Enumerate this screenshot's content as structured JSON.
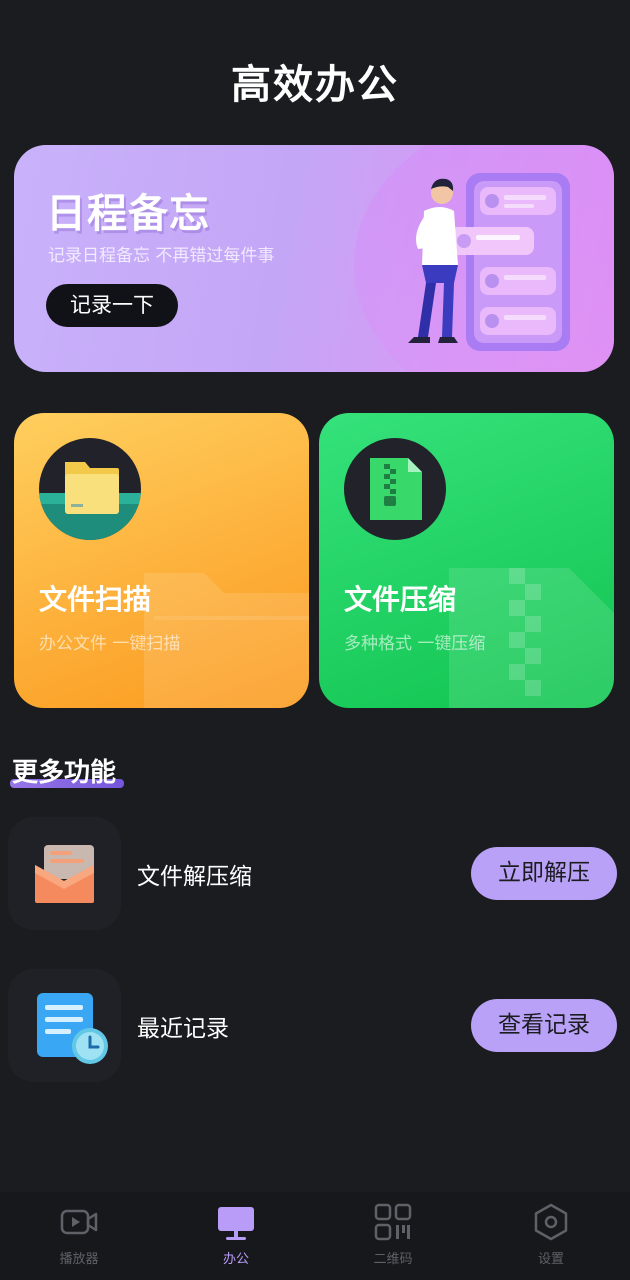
{
  "header": {
    "title": "高效办公"
  },
  "banner": {
    "title": "日程备忘",
    "subtitle": "记录日程备忘  不再错过每件事",
    "button_label": "记录一下"
  },
  "cards": [
    {
      "title": "文件扫描",
      "subtitle": "办公文件  一键扫描",
      "icon": "folder-icon",
      "color": "#fdb33e"
    },
    {
      "title": "文件压缩",
      "subtitle": "多种格式  一键压缩",
      "icon": "zip-file-icon",
      "color": "#22d163"
    }
  ],
  "more": {
    "title": "更多功能",
    "items": [
      {
        "label": "文件解压缩",
        "button_label": "立即解压",
        "icon": "open-envelope-icon"
      },
      {
        "label": "最近记录",
        "button_label": "查看记录",
        "icon": "document-clock-icon"
      }
    ]
  },
  "bottom_nav": {
    "items": [
      {
        "label": "播放器",
        "icon": "video-player-icon",
        "active": false
      },
      {
        "label": "办公",
        "icon": "monitor-icon",
        "active": true
      },
      {
        "label": "二维码",
        "icon": "qr-code-icon",
        "active": false
      },
      {
        "label": "设置",
        "icon": "hexagon-settings-icon",
        "active": false
      }
    ]
  },
  "colors": {
    "background": "#1b1c20",
    "accent": "#b8a1f6",
    "scan_card": "#fdb33e",
    "zip_card": "#22d163",
    "banner": "#c9b2fb"
  }
}
